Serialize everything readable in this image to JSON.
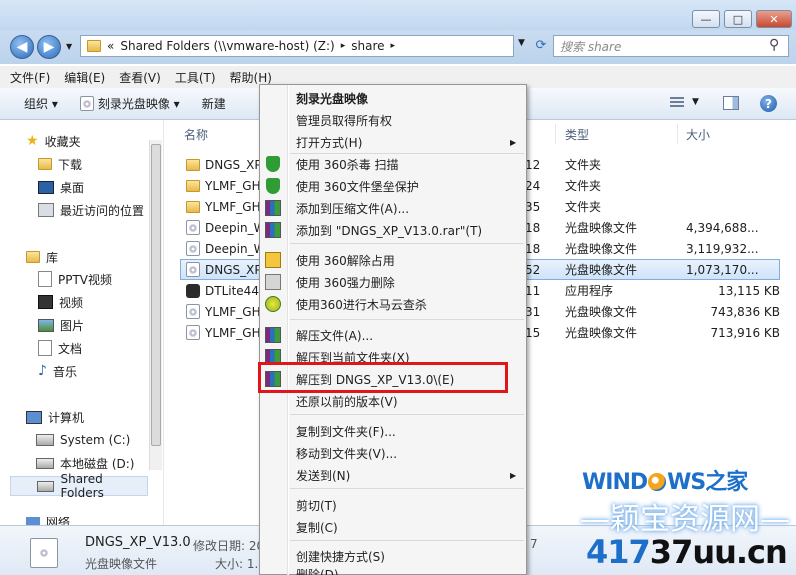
{
  "titlebar": {
    "minimize": "—",
    "maximize": "□",
    "close": "✕"
  },
  "address": {
    "overflow": "«",
    "path": "Shared Folders (\\\\vmware-host) (Z:)",
    "sep": "▸",
    "current": "share",
    "search_placeholder": "搜索 share"
  },
  "menubar": [
    "文件(F)",
    "编辑(E)",
    "查看(V)",
    "工具(T)",
    "帮助(H)"
  ],
  "toolbar": {
    "organize": "组织 ▾",
    "burn": "刻录光盘映像 ▾",
    "new": "新建"
  },
  "nav": {
    "favorites": "收藏夹",
    "downloads": "下载",
    "desktop": "桌面",
    "recent": "最近访问的位置",
    "libraries": "库",
    "pptv": "PPTV视频",
    "video": "视频",
    "pictures": "图片",
    "documents": "文档",
    "music": "音乐",
    "computer": "计算机",
    "system_c": "System (C:)",
    "local_d": "本地磁盘 (D:)",
    "shared": "Shared Folders",
    "network": "网络"
  },
  "columns": {
    "name": "名称",
    "type": "类型",
    "size": "大小"
  },
  "files": [
    {
      "name": "DNGS_XP",
      "date": "12",
      "type": "文件夹",
      "size": ""
    },
    {
      "name": "YLMF_GH",
      "date": "24",
      "type": "文件夹",
      "size": ""
    },
    {
      "name": "YLMF_GH",
      "date": "35",
      "type": "文件夹",
      "size": ""
    },
    {
      "name": "Deepin_W",
      "date": "18",
      "type": "光盘映像文件",
      "size": "4,394,688..."
    },
    {
      "name": "Deepin_W",
      "date": "18",
      "type": "光盘映像文件",
      "size": "3,119,932..."
    },
    {
      "name": "DNGS_XP",
      "date": "52",
      "type": "光盘映像文件",
      "size": "1,073,170..."
    },
    {
      "name": "DTLite449",
      "date": "11",
      "type": "应用程序",
      "size": "13,115 KB"
    },
    {
      "name": "YLMF_GH",
      "date": "31",
      "type": "光盘映像文件",
      "size": "743,836 KB"
    },
    {
      "name": "YLMF_GH",
      "date": "15",
      "type": "光盘映像文件",
      "size": "713,916 KB"
    }
  ],
  "status": {
    "filename": "DNGS_XP_V13.0",
    "modified_label": "修改日期: 20",
    "filetype": "光盘映像文件",
    "size_label": "大小: 1.",
    "right_digit": "7"
  },
  "context_menu": {
    "items": [
      "刻录光盘映像",
      "管理员取得所有权",
      "打开方式(H)",
      "使用 360杀毒 扫描",
      "使用 360文件堡垒保护",
      "添加到压缩文件(A)...",
      "添加到 \"DNGS_XP_V13.0.rar\"(T)",
      "使用 360解除占用",
      "使用 360强力删除",
      "使用360进行木马云查杀",
      "解压文件(A)...",
      "解压到当前文件夹(X)",
      "解压到 DNGS_XP_V13.0\\(E)",
      "还原以前的版本(V)",
      "复制到文件夹(F)...",
      "移动到文件夹(V)...",
      "发送到(N)",
      "剪切(T)",
      "复制(C)",
      "创建快捷方式(S)",
      "删除(D)"
    ],
    "submenu_arrow": "▶"
  },
  "watermark": {
    "brand_a": "WIND",
    "brand_b": "WS之家",
    "site_name": "—颖宝资源网—",
    "url_a": "417",
    "url_b": "37uu.cn"
  },
  "colors": {
    "highlight_box": "#e0161a",
    "brand_blue": "#1d6fc9"
  },
  "icons": [
    "folder-icon",
    "disc-image-icon",
    "rar-icon",
    "360-shield-icon",
    "search-icon",
    "help-icon"
  ]
}
